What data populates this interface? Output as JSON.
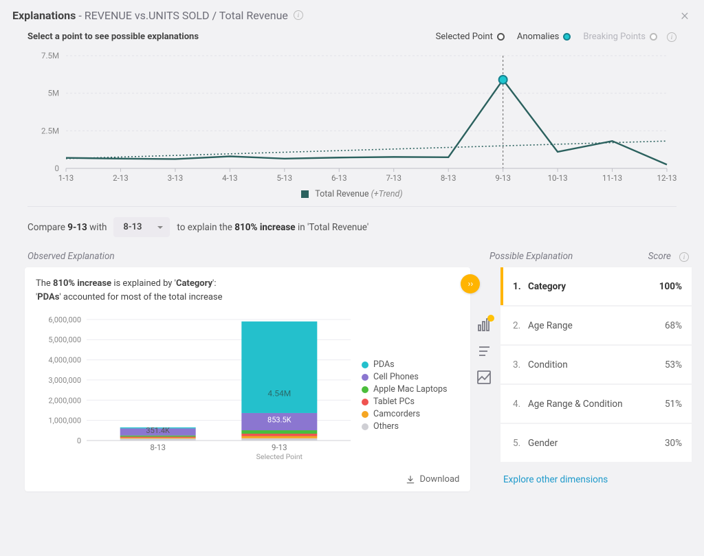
{
  "header": {
    "title_strong": "Explanations",
    "title_sub": "- REVENUE vs.UNITS SOLD / Total Revenue"
  },
  "subheader": {
    "prompt": "Select a point to see possible explanations",
    "legend_selected": "Selected Point",
    "legend_anomalies": "Anomalies",
    "legend_breaking": "Breaking Points"
  },
  "chart_data": {
    "line": {
      "type": "line",
      "title": "",
      "xlabel": "",
      "ylabel": "",
      "y_ticks": [
        0,
        2500000,
        5000000,
        7500000
      ],
      "y_tick_labels": [
        "0",
        "2.5M",
        "5M",
        "7.5M"
      ],
      "categories": [
        "1-13",
        "2-13",
        "3-13",
        "4-13",
        "5-13",
        "6-13",
        "7-13",
        "8-13",
        "9-13",
        "10-13",
        "11-13",
        "12-13"
      ],
      "series": [
        {
          "name": "Total Revenue",
          "values": [
            700000,
            650000,
            620000,
            800000,
            650000,
            720000,
            760000,
            740000,
            5900000,
            1100000,
            1820000,
            250000
          ]
        }
      ],
      "trend": {
        "name": "Trend",
        "start": 650000,
        "end": 1820000
      },
      "anomaly_index": 8,
      "ylim": [
        0,
        7500000
      ],
      "legend_label": "Total Revenue",
      "legend_trend": "(+Trend)"
    },
    "bar": {
      "type": "bar-stacked",
      "categories": [
        "8-13",
        "9-13"
      ],
      "category_sub": [
        "",
        "Selected Point"
      ],
      "y_ticks": [
        0,
        1000000,
        2000000,
        3000000,
        4000000,
        5000000,
        6000000
      ],
      "y_tick_labels": [
        "0",
        "1,000,000",
        "2,000,000",
        "3,000,000",
        "4,000,000",
        "5,000,000",
        "6,000,000"
      ],
      "ylim": [
        0,
        6200000
      ],
      "series": [
        {
          "name": "PDAs",
          "color": "#24c0cc",
          "values": [
            50000,
            4540000
          ]
        },
        {
          "name": "Cell Phones",
          "color": "#8b76d0",
          "values": [
            351400,
            853500
          ]
        },
        {
          "name": "Apple Mac Laptops",
          "color": "#4bbd3c",
          "values": [
            60000,
            170000
          ]
        },
        {
          "name": "Tablet PCs",
          "color": "#ef5350",
          "values": [
            50000,
            120000
          ]
        },
        {
          "name": "Camcorders",
          "color": "#f5a623",
          "values": [
            40000,
            110000
          ]
        },
        {
          "name": "Others",
          "color": "#cfcfd4",
          "values": [
            100000,
            110000
          ]
        }
      ],
      "value_labels": {
        "0": "351.4K",
        "1_pdas": "4.54M",
        "1_cell": "853.5K"
      }
    }
  },
  "compare": {
    "prefix": "Compare",
    "point": "9-13",
    "with": "with",
    "dropdown_value": "8-13",
    "explain_prefix": "to explain the",
    "pct": "810% increase",
    "suffix": "in 'Total Revenue'"
  },
  "headings": {
    "observed": "Observed Explanation",
    "possible": "Possible Explanation",
    "score": "Score"
  },
  "observed": {
    "line1_pre": "The ",
    "line1_bold1": "810% increase",
    "line1_mid": " is explained by '",
    "line1_bold2": "Category",
    "line1_post": "':",
    "line2_pre": "'",
    "line2_bold": "PDAs",
    "line2_post": "' accounted for most of the total increase",
    "download": "Download"
  },
  "possible": {
    "items": [
      {
        "num": "1.",
        "label": "Category",
        "score": "100%"
      },
      {
        "num": "2.",
        "label": "Age Range",
        "score": "68%"
      },
      {
        "num": "3.",
        "label": "Condition",
        "score": "53%"
      },
      {
        "num": "4.",
        "label": "Age Range & Condition",
        "score": "51%"
      },
      {
        "num": "5.",
        "label": "Gender",
        "score": "30%"
      }
    ],
    "explore": "Explore other dimensions",
    "forward_glyph": "››"
  }
}
